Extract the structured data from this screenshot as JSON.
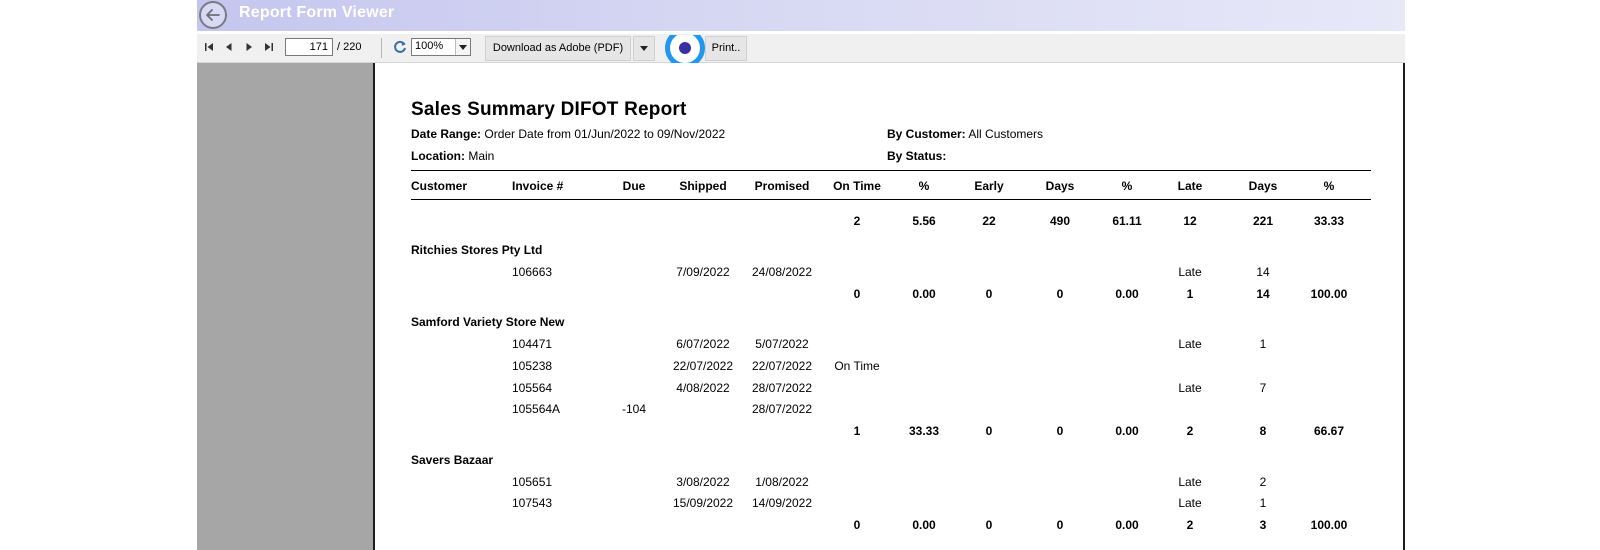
{
  "window": {
    "title": "Report Form Viewer"
  },
  "toolbar": {
    "current_page": "171",
    "total_pages": "/ 220",
    "zoom": "100%",
    "download_label": "Download as Adobe (PDF)",
    "print_label": "Print.."
  },
  "report": {
    "title": "Sales Summary DIFOT Report",
    "meta": {
      "date_range_label": "Date Range:",
      "date_range_value": "Order Date from 01/Jun/2022 to 09/Nov/2022",
      "by_customer_label": "By Customer:",
      "by_customer_value": "All Customers",
      "location_label": "Location:",
      "location_value": "Main",
      "by_status_label": "By Status:",
      "by_status_value": ""
    },
    "columns": [
      "Customer",
      "Invoice #",
      "Due",
      "Shipped",
      "Promised",
      "On Time",
      "%",
      "Early",
      "Days",
      "%",
      "Late",
      "Days",
      "%"
    ],
    "grand_total": [
      "2",
      "5.56",
      "22",
      "490",
      "61.11",
      "12",
      "221",
      "33.33"
    ],
    "groups": [
      {
        "customer": "Ritchies Stores Pty Ltd",
        "rows": [
          {
            "invoice": "106663",
            "due": "",
            "shipped": "7/09/2022",
            "promised": "24/08/2022",
            "status": "Late",
            "days": "14"
          }
        ],
        "subtotal": [
          "0",
          "0.00",
          "0",
          "0",
          "0.00",
          "1",
          "14",
          "100.00"
        ]
      },
      {
        "customer": "Samford Variety Store New",
        "rows": [
          {
            "invoice": "104471",
            "due": "",
            "shipped": "6/07/2022",
            "promised": "5/07/2022",
            "status": "Late",
            "days": "1"
          },
          {
            "invoice": "105238",
            "due": "",
            "shipped": "22/07/2022",
            "promised": "22/07/2022",
            "status": "On Time",
            "days": ""
          },
          {
            "invoice": "105564",
            "due": "",
            "shipped": "4/08/2022",
            "promised": "28/07/2022",
            "status": "Late",
            "days": "7"
          },
          {
            "invoice": "105564A",
            "due": "-104",
            "shipped": "",
            "promised": "28/07/2022",
            "status": "",
            "days": ""
          }
        ],
        "subtotal": [
          "1",
          "33.33",
          "0",
          "0",
          "0.00",
          "2",
          "8",
          "66.67"
        ]
      },
      {
        "customer": "Savers Bazaar",
        "rows": [
          {
            "invoice": "105651",
            "due": "",
            "shipped": "3/08/2022",
            "promised": "1/08/2022",
            "status": "Late",
            "days": "2"
          },
          {
            "invoice": "107543",
            "due": "",
            "shipped": "15/09/2022",
            "promised": "14/09/2022",
            "status": "Late",
            "days": "1"
          }
        ],
        "subtotal": [
          "0",
          "0.00",
          "0",
          "0",
          "0.00",
          "2",
          "3",
          "100.00"
        ]
      }
    ]
  },
  "icons": {
    "back": "back-arrow-icon",
    "first": "first-page-icon",
    "prev": "previous-page-icon",
    "next": "next-page-icon",
    "last": "last-page-icon",
    "refresh": "refresh-icon",
    "dropdown": "chevron-down-icon"
  },
  "colors": {
    "titlebar": "#c4c6ef",
    "pane": "#a6a6a6",
    "cursor_ring": "#2196f3"
  }
}
